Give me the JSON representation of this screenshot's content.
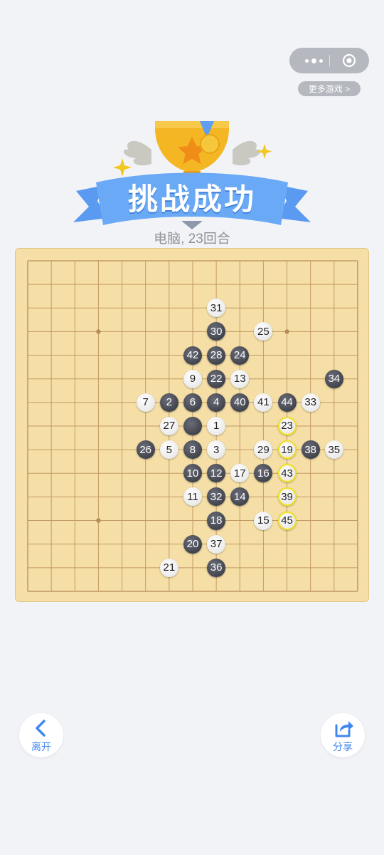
{
  "header": {
    "more_games": "更多游戏 >",
    "menu_icon": "more-dots-icon",
    "close_icon": "target-circle-icon"
  },
  "result": {
    "title": "挑战成功",
    "subtitle": "电脑, 23回合"
  },
  "board": {
    "size": 15,
    "star_points": [
      [
        3,
        3
      ],
      [
        11,
        3
      ],
      [
        3,
        11
      ],
      [
        11,
        11
      ]
    ],
    "stones": [
      {
        "n": "1",
        "color": "white",
        "col": 8,
        "row": 7
      },
      {
        "n": "2",
        "color": "black",
        "col": 6,
        "row": 6
      },
      {
        "n": "3",
        "color": "white",
        "col": 8,
        "row": 8
      },
      {
        "n": "4",
        "color": "black",
        "col": 8,
        "row": 6
      },
      {
        "n": "5",
        "color": "white",
        "col": 6,
        "row": 8
      },
      {
        "n": "6",
        "color": "black",
        "col": 7,
        "row": 6
      },
      {
        "n": "7",
        "color": "white",
        "col": 5,
        "row": 6
      },
      {
        "n": "8",
        "color": "black",
        "col": 7,
        "row": 8
      },
      {
        "n": "9",
        "color": "white",
        "col": 7,
        "row": 5
      },
      {
        "n": "10",
        "color": "black",
        "col": 7,
        "row": 9
      },
      {
        "n": "11",
        "color": "white",
        "col": 7,
        "row": 10
      },
      {
        "n": "12",
        "color": "black",
        "col": 8,
        "row": 9
      },
      {
        "n": "13",
        "color": "white",
        "col": 9,
        "row": 5
      },
      {
        "n": "14",
        "color": "black",
        "col": 9,
        "row": 10
      },
      {
        "n": "15",
        "color": "white",
        "col": 10,
        "row": 11
      },
      {
        "n": "16",
        "color": "black",
        "col": 10,
        "row": 9
      },
      {
        "n": "17",
        "color": "white",
        "col": 9,
        "row": 9
      },
      {
        "n": "18",
        "color": "black",
        "col": 8,
        "row": 11
      },
      {
        "n": "19",
        "color": "white",
        "col": 11,
        "row": 8,
        "win": true
      },
      {
        "n": "20",
        "color": "black",
        "col": 7,
        "row": 12
      },
      {
        "n": "21",
        "color": "white",
        "col": 6,
        "row": 13
      },
      {
        "n": "22",
        "color": "black",
        "col": 8,
        "row": 5
      },
      {
        "n": "23",
        "color": "white",
        "col": 11,
        "row": 7,
        "win": true
      },
      {
        "n": "24",
        "color": "black",
        "col": 9,
        "row": 4
      },
      {
        "n": "25",
        "color": "white",
        "col": 10,
        "row": 3
      },
      {
        "n": "26",
        "color": "black",
        "col": 5,
        "row": 8
      },
      {
        "n": "27",
        "color": "white",
        "col": 6,
        "row": 7
      },
      {
        "n": "28",
        "color": "black",
        "col": 8,
        "row": 4
      },
      {
        "n": "29",
        "color": "white",
        "col": 10,
        "row": 8
      },
      {
        "n": "30",
        "color": "black",
        "col": 8,
        "row": 3
      },
      {
        "n": "31",
        "color": "white",
        "col": 8,
        "row": 2
      },
      {
        "n": "32",
        "color": "black",
        "col": 8,
        "row": 10
      },
      {
        "n": "33",
        "color": "white",
        "col": 12,
        "row": 6
      },
      {
        "n": "34",
        "color": "black",
        "col": 13,
        "row": 5
      },
      {
        "n": "35",
        "color": "white",
        "col": 13,
        "row": 8
      },
      {
        "n": "36",
        "color": "black",
        "col": 8,
        "row": 13
      },
      {
        "n": "37",
        "color": "white",
        "col": 8,
        "row": 12
      },
      {
        "n": "38",
        "color": "black",
        "col": 12,
        "row": 8
      },
      {
        "n": "39",
        "color": "white",
        "col": 11,
        "row": 10,
        "win": true
      },
      {
        "n": "40",
        "color": "black",
        "col": 9,
        "row": 6
      },
      {
        "n": "41",
        "color": "white",
        "col": 10,
        "row": 6
      },
      {
        "n": "42",
        "color": "black",
        "col": 7,
        "row": 4
      },
      {
        "n": "43",
        "color": "white",
        "col": 11,
        "row": 9,
        "win": true
      },
      {
        "n": "44",
        "color": "black",
        "col": 11,
        "row": 6
      },
      {
        "n": "45",
        "color": "white",
        "col": 11,
        "row": 11,
        "win": true
      },
      {
        "n": "",
        "color": "black",
        "col": 7,
        "row": 7
      }
    ]
  },
  "footer": {
    "leave_label": "离开",
    "share_label": "分享"
  }
}
